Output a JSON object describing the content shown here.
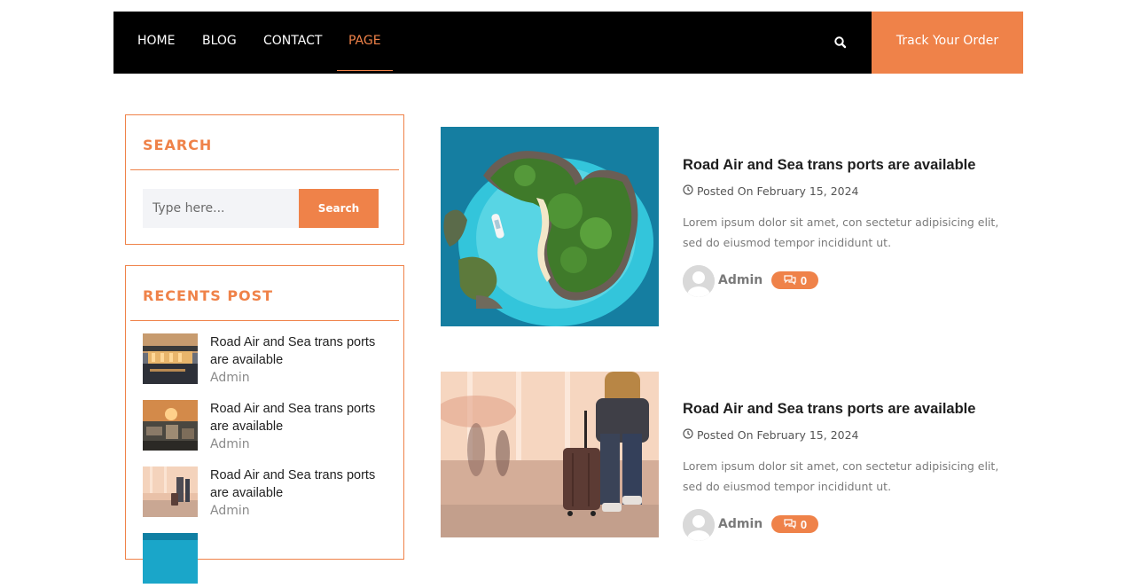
{
  "nav": {
    "items": [
      {
        "label": "HOME",
        "active": false
      },
      {
        "label": "BLOG",
        "active": false
      },
      {
        "label": "CONTACT",
        "active": false
      },
      {
        "label": "PAGE",
        "active": true
      }
    ],
    "search_icon": "search-icon",
    "track_label": "Track Your Order"
  },
  "colors": {
    "accent": "#ef8249",
    "nav_bg": "#000000"
  },
  "sidebar": {
    "search": {
      "title": "SEARCH",
      "placeholder": "Type here...",
      "button_label": "Search"
    },
    "recent": {
      "title": "RECENTS POST",
      "items": [
        {
          "title": "Road Air and Sea trans ports are available",
          "author": "Admin"
        },
        {
          "title": "Road Air and Sea trans ports are available",
          "author": "Admin"
        },
        {
          "title": "Road Air and Sea trans ports are available",
          "author": "Admin"
        }
      ]
    }
  },
  "posts": [
    {
      "title": "Road Air and Sea trans ports are available",
      "date": "Posted On February 15, 2024",
      "excerpt": "Lorem ipsum dolor sit amet, con sectetur adipisicing elit, sed do eiusmod tempor incididunt ut.",
      "author": "Admin",
      "comments": "0"
    },
    {
      "title": "Road Air and Sea trans ports are available",
      "date": "Posted On February 15, 2024",
      "excerpt": "Lorem ipsum dolor sit amet, con sectetur adipisicing elit, sed do eiusmod tempor incididunt ut.",
      "author": "Admin",
      "comments": "0"
    }
  ]
}
